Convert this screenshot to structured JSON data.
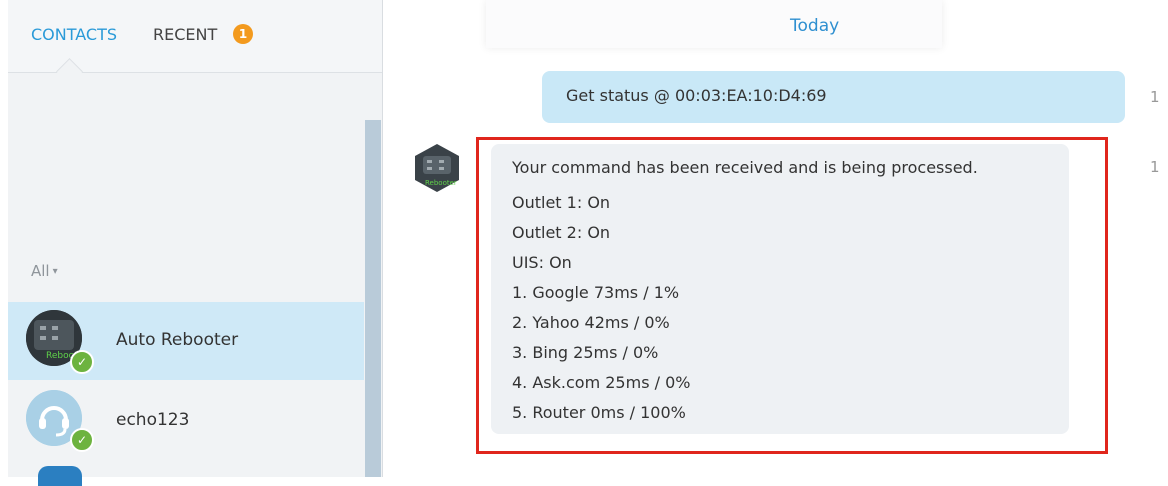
{
  "tabs": {
    "contacts_label": "CONTACTS",
    "recent_label": "RECENT",
    "recent_badge": "1"
  },
  "filter": {
    "label": "All",
    "caret": "▾"
  },
  "contacts": [
    {
      "name": "Auto Rebooter",
      "avatar_text": "Auto Rebooter",
      "status": "online",
      "selected": true
    },
    {
      "name": "echo123",
      "status": "online",
      "selected": false
    }
  ],
  "chat": {
    "day_label": "Today",
    "outgoing": {
      "text": "Get status @ 00:03:EA:10:D4:69",
      "time_fragment": "1"
    },
    "incoming": {
      "time_fragment": "1",
      "lines": [
        "Your command has been received and is being processed.",
        "Outlet 1: On",
        "Outlet 2: On",
        "UIS: On",
        "1. Google 73ms / 1%",
        "2. Yahoo 42ms / 0%",
        "3. Bing 25ms / 0%",
        "4. Ask.com 25ms / 0%",
        "5. Router 0ms / 100%"
      ]
    }
  },
  "colors": {
    "accent": "#2a9ad8",
    "badge": "#f39a1e",
    "presence": "#6db33f",
    "highlight": "#e0261c",
    "selected_row": "#cfe9f7",
    "outgoing_bubble": "#c9e8f7"
  },
  "icons": {
    "presence": "check-icon",
    "filter": "chevron-down-icon",
    "echo_avatar": "headset-icon"
  }
}
